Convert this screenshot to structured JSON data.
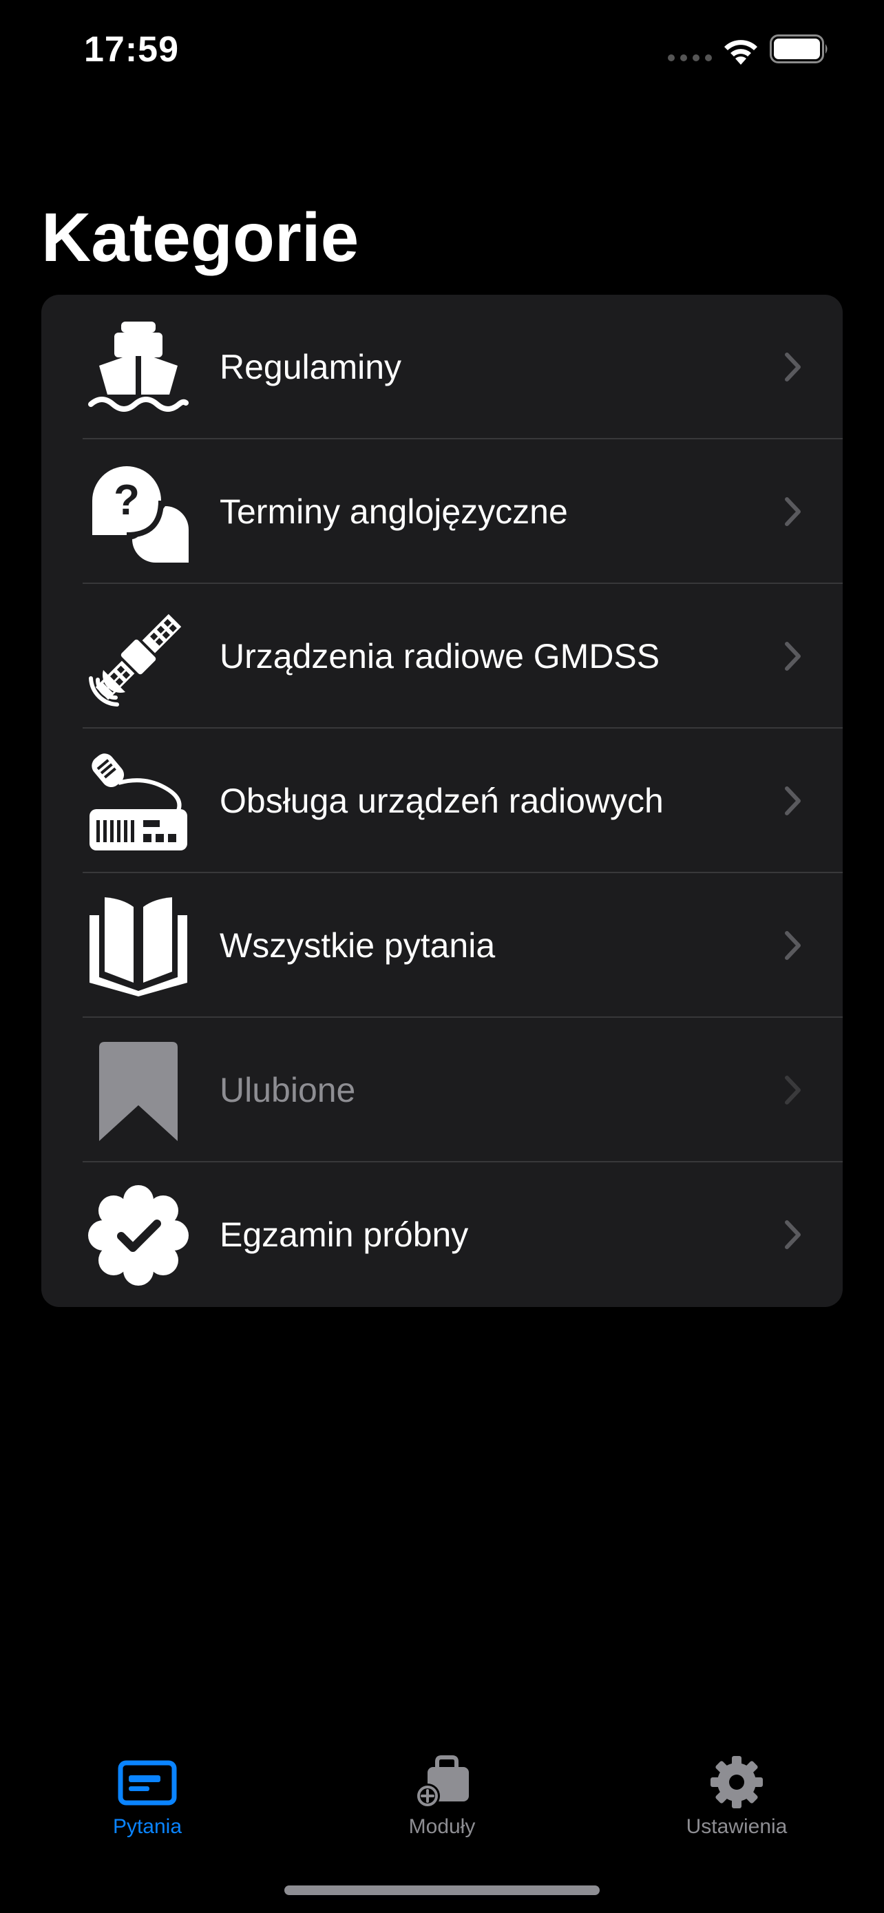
{
  "status_bar": {
    "time": "17:59"
  },
  "page": {
    "title": "Kategorie"
  },
  "categories": [
    {
      "label": "Regulaminy",
      "icon": "ship-icon",
      "enabled": true
    },
    {
      "label": "Terminy anglojęzyczne",
      "icon": "question-bubble-icon",
      "enabled": true
    },
    {
      "label": "Urządzenia radiowe GMDSS",
      "icon": "satellite-icon",
      "enabled": true
    },
    {
      "label": "Obsługa urządzeń radiowych",
      "icon": "radio-device-icon",
      "enabled": true
    },
    {
      "label": "Wszystkie pytania",
      "icon": "book-icon",
      "enabled": true
    },
    {
      "label": "Ulubione",
      "icon": "bookmark-icon",
      "enabled": false
    },
    {
      "label": "Egzamin próbny",
      "icon": "checkmark-seal-icon",
      "enabled": true
    }
  ],
  "tab_bar": {
    "tabs": [
      {
        "label": "Pytania",
        "icon": "card-icon",
        "active": true
      },
      {
        "label": "Moduły",
        "icon": "bag-add-icon",
        "active": false
      },
      {
        "label": "Ustawienia",
        "icon": "gear-icon",
        "active": false
      }
    ]
  },
  "colors": {
    "background": "#000000",
    "card": "#1c1c1e",
    "accent": "#0a84ff",
    "secondary_text": "#8e8e93"
  }
}
